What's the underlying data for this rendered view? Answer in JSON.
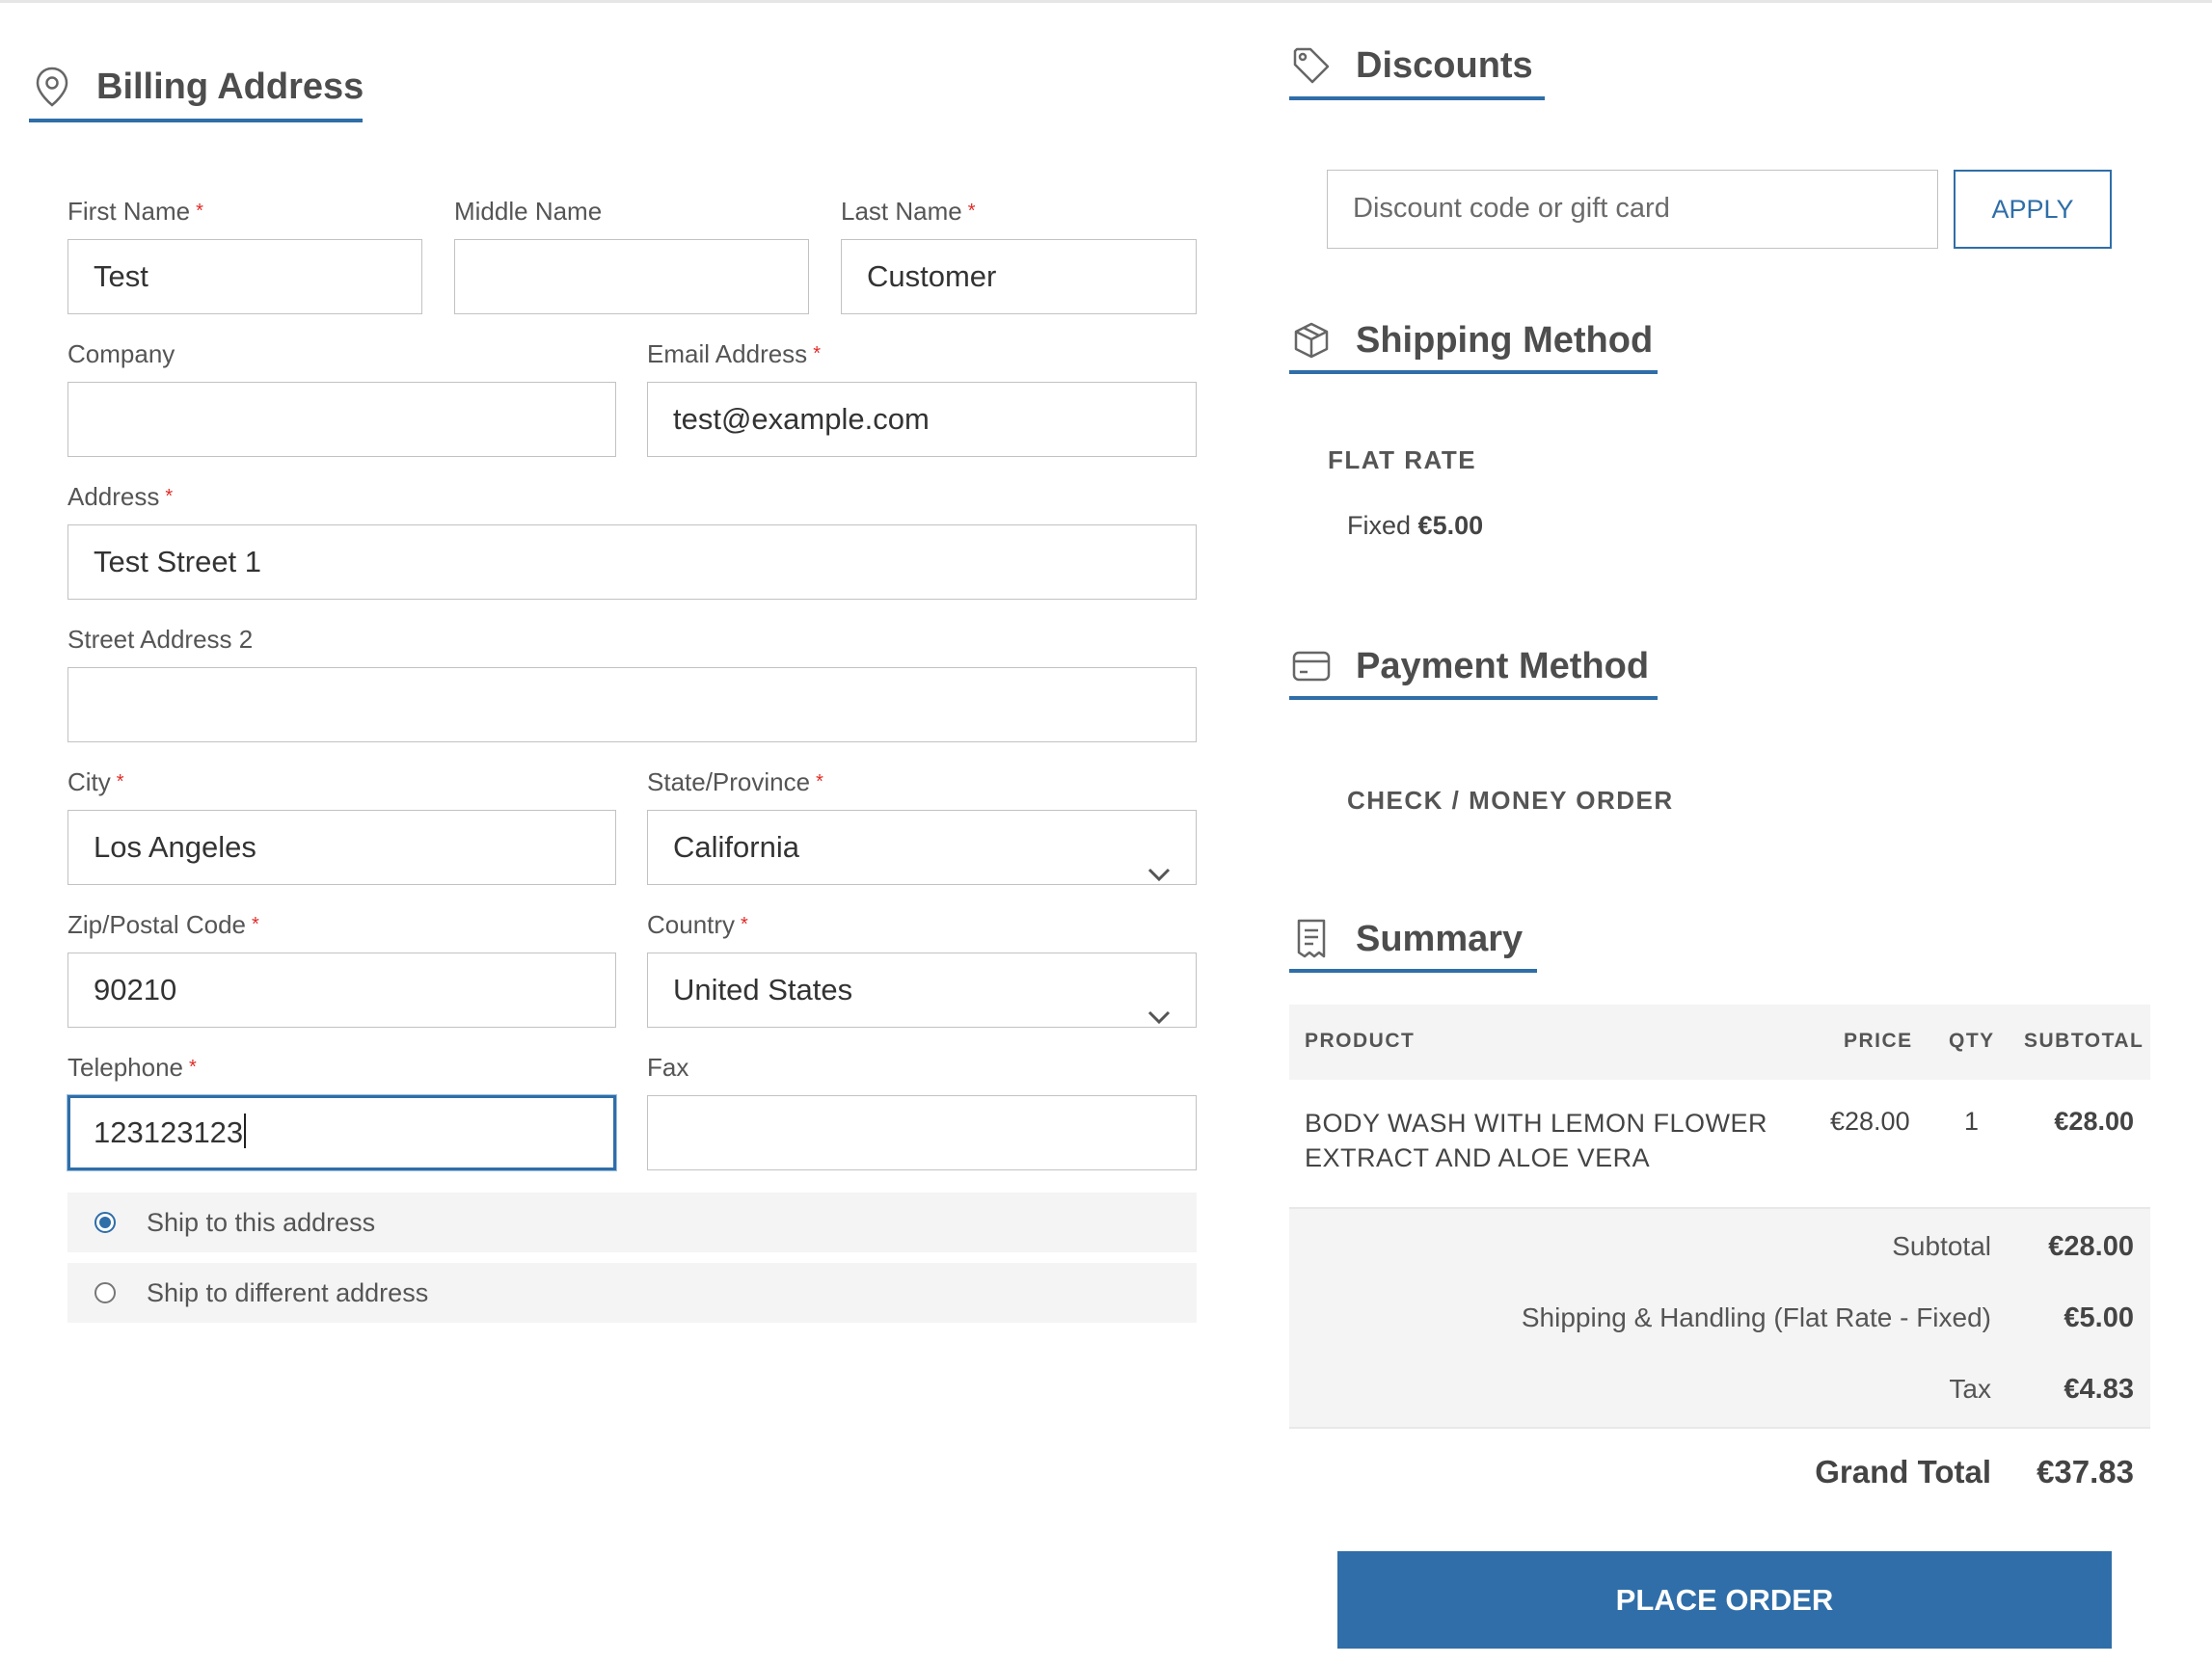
{
  "billing": {
    "title": "Billing Address",
    "fields": {
      "first_name": {
        "label": "First Name",
        "value": "Test"
      },
      "middle_name": {
        "label": "Middle Name",
        "value": ""
      },
      "last_name": {
        "label": "Last Name",
        "value": "Customer"
      },
      "company": {
        "label": "Company",
        "value": ""
      },
      "email": {
        "label": "Email Address",
        "value": "test@example.com"
      },
      "address": {
        "label": "Address",
        "value": "Test Street 1"
      },
      "street2": {
        "label": "Street Address 2",
        "value": ""
      },
      "city": {
        "label": "City",
        "value": "Los Angeles"
      },
      "state": {
        "label": "State/Province",
        "value": "California"
      },
      "zip": {
        "label": "Zip/Postal Code",
        "value": "90210"
      },
      "country": {
        "label": "Country",
        "value": "United States"
      },
      "telephone": {
        "label": "Telephone",
        "value": "123123123"
      },
      "fax": {
        "label": "Fax",
        "value": ""
      }
    },
    "required_marker": "*",
    "ship_options": [
      {
        "label": "Ship to this address",
        "selected": true
      },
      {
        "label": "Ship to different address",
        "selected": false
      }
    ]
  },
  "discounts": {
    "title": "Discounts",
    "placeholder": "Discount code or gift card",
    "apply_label": "APPLY"
  },
  "shipping": {
    "title": "Shipping Method",
    "method": "FLAT RATE",
    "rate_label": "Fixed",
    "rate_price": "€5.00"
  },
  "payment": {
    "title": "Payment Method",
    "method": "CHECK / MONEY ORDER"
  },
  "summary": {
    "title": "Summary",
    "columns": [
      "PRODUCT",
      "PRICE",
      "QTY",
      "SUBTOTAL"
    ],
    "items": [
      {
        "product": "BODY WASH WITH LEMON FLOWER EXTRACT AND ALOE VERA",
        "price": "€28.00",
        "qty": "1",
        "subtotal": "€28.00"
      }
    ],
    "totals": [
      {
        "label": "Subtotal",
        "value": "€28.00"
      },
      {
        "label": "Shipping & Handling (Flat Rate - Fixed)",
        "value": "€5.00"
      },
      {
        "label": "Tax",
        "value": "€4.83"
      }
    ],
    "grand_total_label": "Grand Total",
    "grand_total_value": "€37.83",
    "place_order_label": "PLACE ORDER"
  },
  "colors": {
    "accent": "#2f6ea8",
    "required": "#e02b27",
    "panel_bg": "#f4f4f4"
  },
  "icons": {
    "billing": "map-pin-icon",
    "discounts": "tag-icon",
    "shipping": "box-icon",
    "payment": "credit-card-icon",
    "summary": "receipt-icon",
    "select": "chevron-down-icon"
  }
}
